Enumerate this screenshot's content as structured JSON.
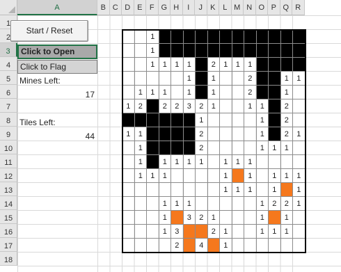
{
  "columns": [
    "A",
    "B",
    "C",
    "D",
    "E",
    "F",
    "G",
    "H",
    "I",
    "J",
    "K",
    "L",
    "M",
    "N",
    "O",
    "P",
    "Q",
    "R"
  ],
  "rows": [
    "1",
    "2",
    "3",
    "4",
    "5",
    "6",
    "7",
    "8",
    "9",
    "10",
    "11",
    "12",
    "13",
    "14",
    "15",
    "16",
    "17",
    "18"
  ],
  "selected_cell": "A3",
  "start_button": {
    "label": "Start / Reset"
  },
  "click_open_label": "Click to Open",
  "click_flag_label": "Click to Flag",
  "mines_left": {
    "label": "Mines Left:",
    "value": "17"
  },
  "tiles_left": {
    "label": "Tiles Left:",
    "value": "44"
  },
  "colors": {
    "unrevealed": "#000000",
    "flag": "#f5781d",
    "gridline": "#d9d9d9",
    "board_gridline": "#8c8c8c",
    "selection": "#217346"
  },
  "board": [
    " . . 1 X X X X X X X X X X X X",
    " . . 1 X X X X X X X X X X X X",
    " . . 1 1 1 1 X 2 1 1 1 X X X X",
    " . . . . . 1 X 1 . . 2 X X 1 1",
    " . 1 1 1 . 1 X 1 . . 2 X X 1 .",
    " 1 2 X 2 2 3 2 1 . . 1 1 X 2 .",
    " X X X X X X 1 . . . . 1 X 2 .",
    " 1 1 X X X X 2 . . . . 1 X 2 1",
    " . 1 X X X X 2 . . . . 1 1 1 .",
    " . 1 X 1 1 1 1 . 1 1 1 . . . .",
    " . 1 1 1 . . . . 1 F 1 . 1 1 1",
    " . . . . . . . . 1 1 1 . 1 F 1",
    " . . . 1 1 1 . . . . . 1 2 2 1",
    " . . . 1 F 3 2 1 . . . 1 F 1 .",
    " . . . 1 3 F F 2 1 . . 1 1 1 .",
    " . . . . 2 F 4 F 1 . . . . . ."
  ]
}
